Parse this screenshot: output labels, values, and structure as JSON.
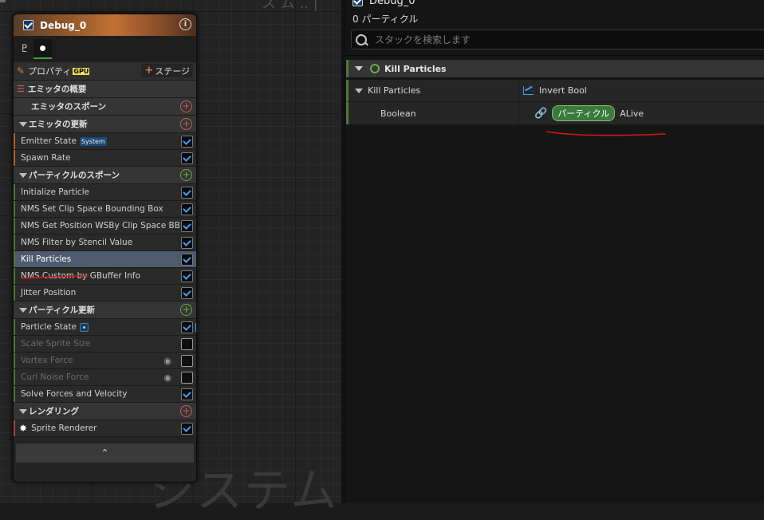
{
  "graph": {
    "watermark": "システム"
  },
  "node": {
    "title": "Debug_0",
    "properties_label": "プロパティ",
    "gpu_badge": "GPU",
    "stage_label": "ステージ",
    "overview_label": "エミッタの概要",
    "sections": {
      "emitter_spawn": "エミッタのスポーン",
      "emitter_update": "エミッタの更新",
      "particle_spawn": "パーティクルのスポーン",
      "particle_update": "パーティクル更新",
      "rendering": "レンダリング"
    },
    "emitter_update_items": [
      {
        "label": "Emitter State",
        "tag": "System",
        "checked": true
      },
      {
        "label": "Spawn Rate",
        "checked": true
      }
    ],
    "particle_spawn_items": [
      {
        "label": "Initialize Particle",
        "checked": true
      },
      {
        "label": "NMS Set Clip Space Bounding Box",
        "checked": true
      },
      {
        "label": "NMS Get Position WSBy Clip Space BB",
        "checked": true
      },
      {
        "label": "NMS Filter by Stencil Value",
        "checked": true
      },
      {
        "label": "Kill Particles",
        "checked": true,
        "selected": true
      },
      {
        "label": "NMS Custom by GBuffer Info",
        "checked": true
      },
      {
        "label": "Jitter Position",
        "checked": true
      }
    ],
    "particle_update_items": [
      {
        "label": "Particle State",
        "checked": true
      },
      {
        "label": "Scale Sprite Size",
        "checked": false
      },
      {
        "label": "Vortex Force",
        "checked": false
      },
      {
        "label": "Curl Noise Force",
        "checked": false
      },
      {
        "label": "Solve Forces and Velocity",
        "checked": true
      }
    ],
    "render_items": [
      {
        "label": "Sprite Renderer",
        "checked": true
      }
    ]
  },
  "panel": {
    "title": "Debug_0",
    "count": "0 パーティクル",
    "search_placeholder": "スタックを検索します",
    "module": {
      "header": "Kill Particles",
      "row1_label": "Kill Particles",
      "row1_value": "Invert Bool",
      "row2_label": "Boolean",
      "pill": "パーティクル",
      "value": "ALive"
    }
  },
  "colors": {
    "accent_blue": "#3aa0ff",
    "header_orange": "#c07036",
    "selected_row": "#4e5a6e",
    "pill_green": "#3a7a3a",
    "annotation_red": "#d01818"
  }
}
